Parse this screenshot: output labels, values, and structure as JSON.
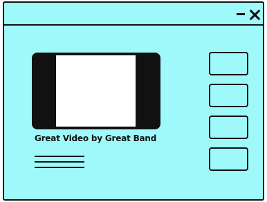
{
  "window": {
    "controls": {
      "minimize_icon": "minimize-icon",
      "close_icon": "close-icon"
    }
  },
  "video": {
    "title": "Great Video by Great Band"
  },
  "sidebar": {
    "items": [
      {
        "label": ""
      },
      {
        "label": ""
      },
      {
        "label": ""
      },
      {
        "label": ""
      }
    ]
  },
  "colors": {
    "background": "#9ff9fb",
    "outline": "#111111",
    "video_frame": "#ffffff"
  }
}
